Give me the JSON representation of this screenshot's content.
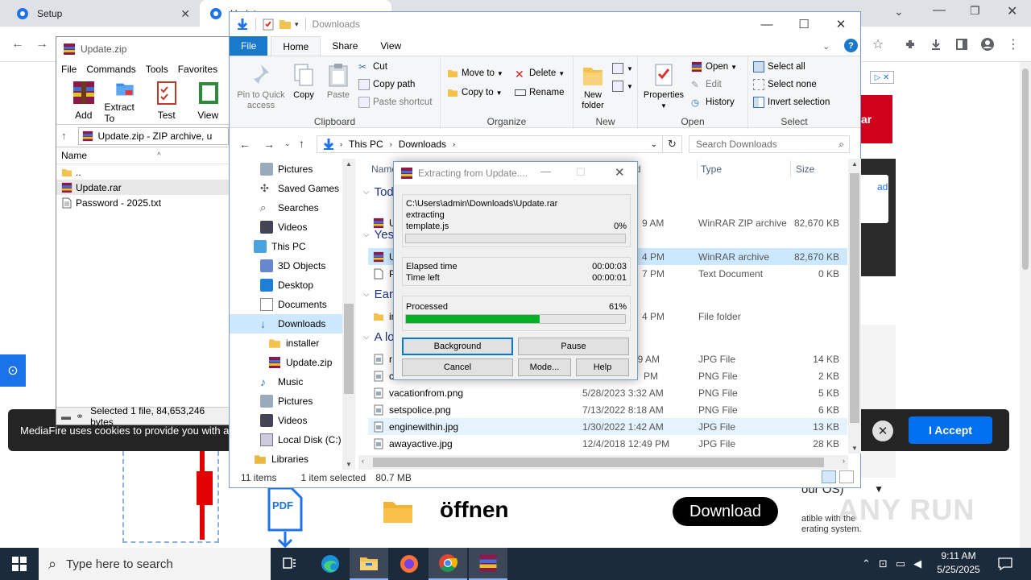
{
  "browser": {
    "tabs": [
      {
        "label": "Setup"
      },
      {
        "label": "Update"
      }
    ],
    "cookie_text": "MediaFire uses cookies to provide you with a",
    "accept_label": "I Accept",
    "ad_text": "ar",
    "ad_card_text": "ad",
    "page_dropdown_text": "our OS)",
    "page_side_text_1": "atible with the",
    "page_side_text_2": "erating system.",
    "pdf_label": "PDF",
    "open_label": "öffnen",
    "download_label": "Download"
  },
  "winrar": {
    "title": "Update.zip",
    "menu": [
      "File",
      "Commands",
      "Tools",
      "Favorites"
    ],
    "tools": [
      {
        "label": "Add",
        "icon": "add-archive-icon"
      },
      {
        "label": "Extract To",
        "icon": "extract-icon"
      },
      {
        "label": "Test",
        "icon": "test-icon"
      },
      {
        "label": "View",
        "icon": "view-icon"
      }
    ],
    "address": "Update.zip - ZIP archive, u",
    "column_name": "Name",
    "rows": [
      {
        "name": "..",
        "icon": "folder-icon"
      },
      {
        "name": "Update.rar",
        "icon": "rar-icon"
      },
      {
        "name": "Password - 2025.txt",
        "icon": "text-file-icon"
      }
    ],
    "status": "Selected 1 file, 84,653,246 bytes"
  },
  "explorer": {
    "title": "Downloads",
    "tabs": [
      "File",
      "Home",
      "Share",
      "View"
    ],
    "ribbon": {
      "clipboard": {
        "label": "Clipboard",
        "pin": "Pin to Quick access",
        "copy": "Copy",
        "paste": "Paste",
        "cut": "Cut",
        "copy_path": "Copy path",
        "paste_shortcut": "Paste shortcut"
      },
      "organize": {
        "label": "Organize",
        "move_to": "Move to",
        "copy_to": "Copy to",
        "delete": "Delete",
        "rename": "Rename"
      },
      "new": {
        "label": "New",
        "new_folder": "New folder"
      },
      "open": {
        "label": "Open",
        "properties": "Properties",
        "open": "Open",
        "edit": "Edit",
        "history": "History"
      },
      "select": {
        "label": "Select",
        "select_all": "Select all",
        "select_none": "Select none",
        "invert": "Invert selection"
      }
    },
    "breadcrumb": [
      "This PC",
      "Downloads"
    ],
    "search_placeholder": "Search Downloads",
    "nav": [
      {
        "label": "Pictures",
        "icon": "pictures-icon",
        "indent": 1
      },
      {
        "label": "Saved Games",
        "icon": "saved-games-icon",
        "indent": 1
      },
      {
        "label": "Searches",
        "icon": "searches-icon",
        "indent": 1
      },
      {
        "label": "Videos",
        "icon": "videos-icon",
        "indent": 1
      },
      {
        "label": "This PC",
        "icon": "this-pc-icon",
        "indent": 0
      },
      {
        "label": "3D Objects",
        "icon": "3d-objects-icon",
        "indent": 1
      },
      {
        "label": "Desktop",
        "icon": "desktop-icon",
        "indent": 1
      },
      {
        "label": "Documents",
        "icon": "documents-icon",
        "indent": 1
      },
      {
        "label": "Downloads",
        "icon": "downloads-icon",
        "indent": 1
      },
      {
        "label": "installer",
        "icon": "folder-icon",
        "indent": 2
      },
      {
        "label": "Update.zip",
        "icon": "zip-icon",
        "indent": 2
      },
      {
        "label": "Music",
        "icon": "music-icon",
        "indent": 1
      },
      {
        "label": "Pictures",
        "icon": "pictures-icon",
        "indent": 1
      },
      {
        "label": "Videos",
        "icon": "videos-icon",
        "indent": 1
      },
      {
        "label": "Local Disk (C:)",
        "icon": "local-disk-icon",
        "indent": 1
      },
      {
        "label": "Libraries",
        "icon": "libraries-icon",
        "indent": 0
      }
    ],
    "columns": {
      "name": "Name",
      "date": "d",
      "type": "Type",
      "size": "Size"
    },
    "groups": [
      "Tod",
      "Yes",
      "Earl",
      "A lo"
    ],
    "files": [
      {
        "name": "U",
        "date": "9 AM",
        "type": "WinRAR ZIP archive",
        "size": "82,670 KB",
        "icon": "zip-icon"
      },
      {
        "name": "U",
        "date": "4 PM",
        "type": "WinRAR archive",
        "size": "82,670 KB",
        "icon": "rar-icon"
      },
      {
        "name": "P",
        "date": "7 PM",
        "type": "Text Document",
        "size": "0 KB",
        "icon": "text-file-icon"
      },
      {
        "name": "in",
        "date": "4 PM",
        "type": "File folder",
        "size": "",
        "icon": "folder-icon"
      },
      {
        "name": "r",
        "date": "59 AM",
        "type": "JPG File",
        "size": "14 KB",
        "icon": "image-file-icon"
      },
      {
        "name": "c",
        "date": "PM",
        "type": "PNG File",
        "size": "2 KB",
        "icon": "image-file-icon"
      },
      {
        "name": "vacationfrom.png",
        "date": "5/28/2023 3:32 AM",
        "type": "PNG File",
        "size": "5 KB",
        "icon": "image-file-icon"
      },
      {
        "name": "setspolice.png",
        "date": "7/13/2022 8:18 AM",
        "type": "PNG File",
        "size": "6 KB",
        "icon": "image-file-icon"
      },
      {
        "name": "enginewithin.jpg",
        "date": "1/30/2022 1:42 AM",
        "type": "JPG File",
        "size": "13 KB",
        "icon": "image-file-icon"
      },
      {
        "name": "awayactive.jpg",
        "date": "12/4/2018 12:49 PM",
        "type": "JPG File",
        "size": "28 KB",
        "icon": "image-file-icon"
      }
    ],
    "status": {
      "items": "11 items",
      "selected": "1 item selected",
      "size": "80.7 MB"
    }
  },
  "extract": {
    "title": "Extracting from Update....",
    "path": "C:\\Users\\admin\\Downloads\\Update.rar",
    "action": "extracting",
    "file": "template.js",
    "file_percent": "0%",
    "file_progress": 0,
    "elapsed_label": "Elapsed time",
    "elapsed": "00:00:03",
    "left_label": "Time left",
    "left": "00:00:01",
    "processed_label": "Processed",
    "processed_percent": "61%",
    "processed_progress": 0.61,
    "buttons": {
      "background": "Background",
      "pause": "Pause",
      "cancel": "Cancel",
      "mode": "Mode...",
      "help": "Help"
    }
  },
  "taskbar": {
    "search_placeholder": "Type here to search",
    "time": "9:11 AM",
    "date": "5/25/2025"
  },
  "watermark": "ANY RUN",
  "colors": {
    "progress": "#06b025",
    "accent": "#0078d7",
    "file_tab": "#1979ca",
    "accept": "#0070f0"
  }
}
